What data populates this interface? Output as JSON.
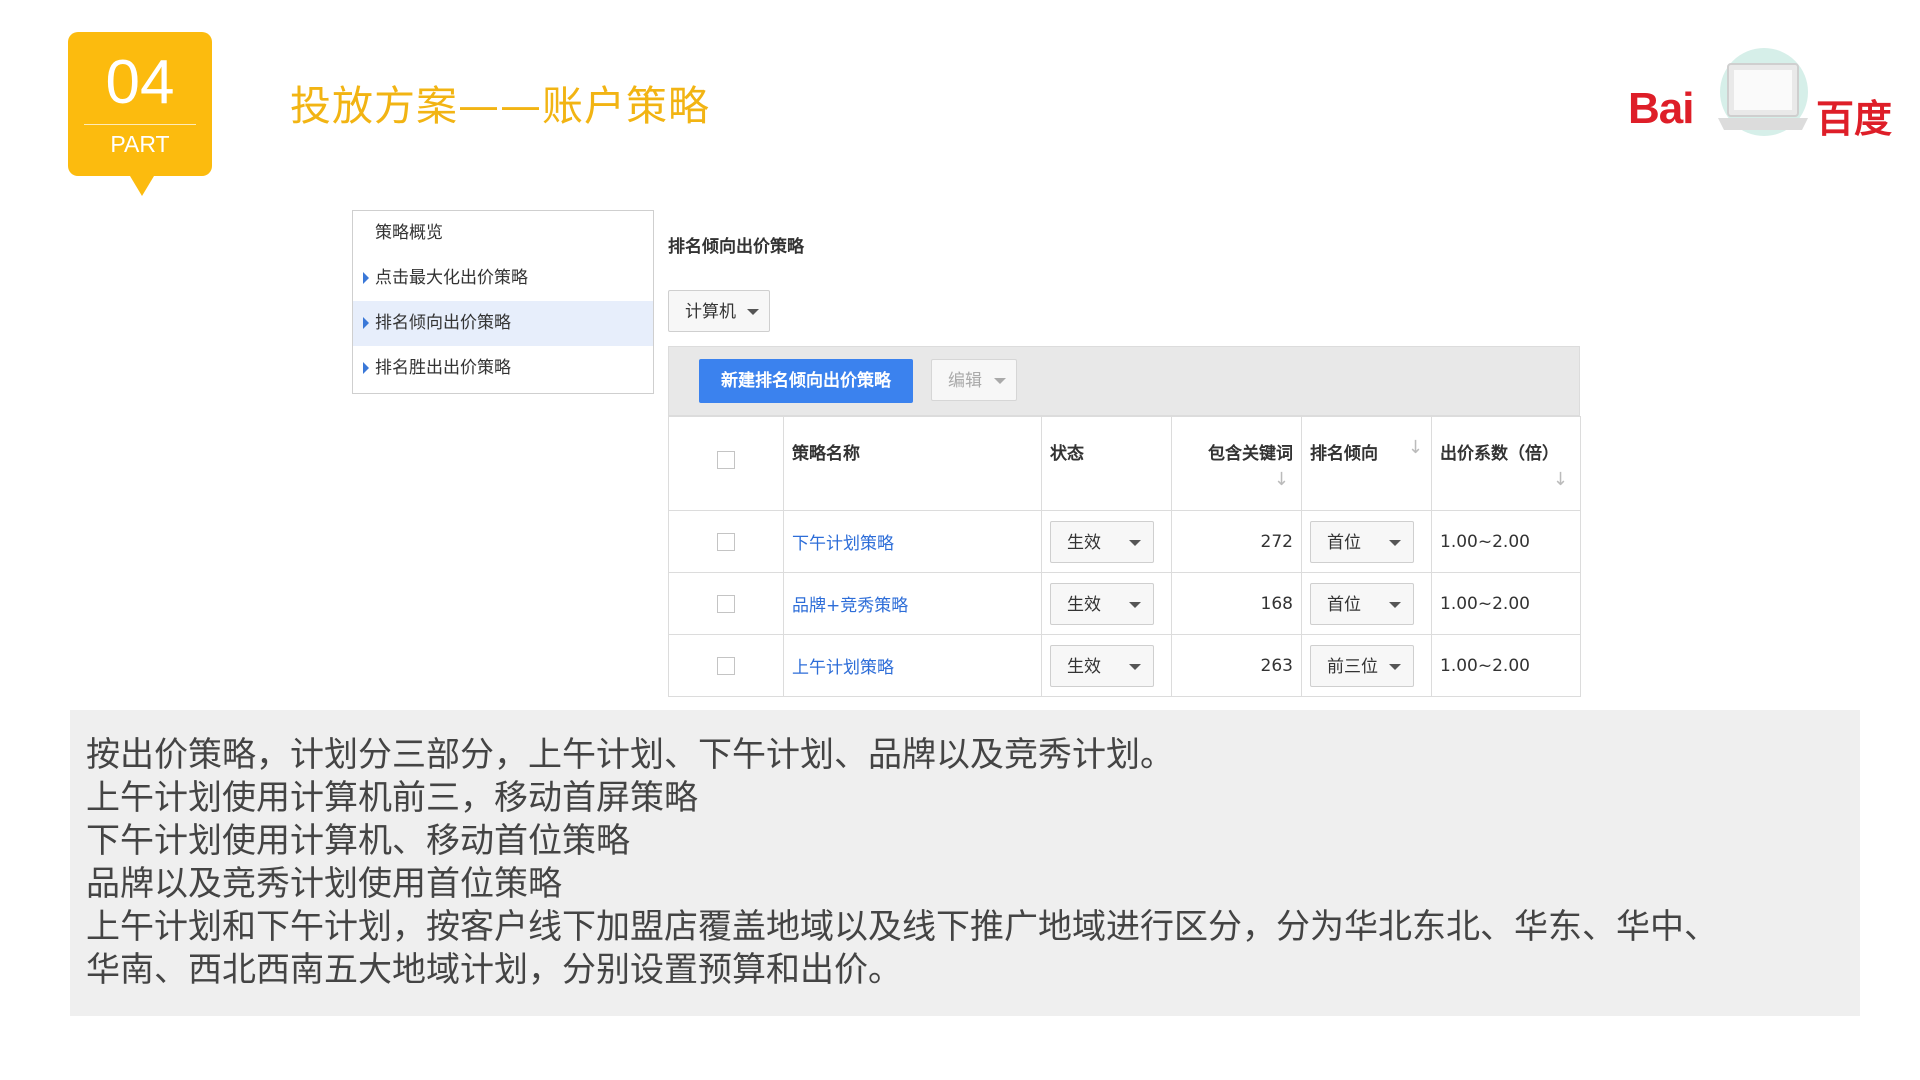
{
  "badge": {
    "number": "04",
    "part": "PART"
  },
  "slide_title": "投放方案——账户策略",
  "logo": {
    "bai": "Bai",
    "du": "百度"
  },
  "menu": {
    "items": [
      {
        "label": "策略概览"
      },
      {
        "label": "点击最大化出价策略"
      },
      {
        "label": "排名倾向出价策略"
      },
      {
        "label": "排名胜出出价策略"
      }
    ]
  },
  "section_title": "排名倾向出价策略",
  "device_select": {
    "value": "计算机"
  },
  "toolbar": {
    "new_button": "新建排名倾向出价策略",
    "edit_button": "编辑"
  },
  "table": {
    "headers": {
      "name": "策略名称",
      "status": "状态",
      "keywords": "包含关键词",
      "rank": "排名倾向",
      "bid": "出价系数（倍）"
    },
    "rows": [
      {
        "name": "下午计划策略",
        "status": "生效",
        "keywords": "272",
        "rank": "首位",
        "bid": "1.00~2.00"
      },
      {
        "name": "品牌+竞秀策略",
        "status": "生效",
        "keywords": "168",
        "rank": "首位",
        "bid": "1.00~2.00"
      },
      {
        "name": "上午计划策略",
        "status": "生效",
        "keywords": "263",
        "rank": "前三位",
        "bid": "1.00~2.00"
      }
    ]
  },
  "note": {
    "lines": [
      "按出价策略，计划分三部分，上午计划、下午计划、品牌以及竞秀计划。",
      "上午计划使用计算机前三，移动首屏策略",
      "下午计划使用计算机、移动首位策略",
      "品牌以及竞秀计划使用首位策略",
      "上午计划和下午计划，按客户线下加盟店覆盖地域以及线下推广地域进行区分，分为华北东北、华东、华中、",
      "华南、西北西南五大地域计划，分别设置预算和出价。"
    ]
  },
  "colors": {
    "accent": "#fcbb0e",
    "title": "#f2b413",
    "link": "#2d6dd8",
    "primary_button": "#3b82ee",
    "brand": "#de1e28"
  }
}
